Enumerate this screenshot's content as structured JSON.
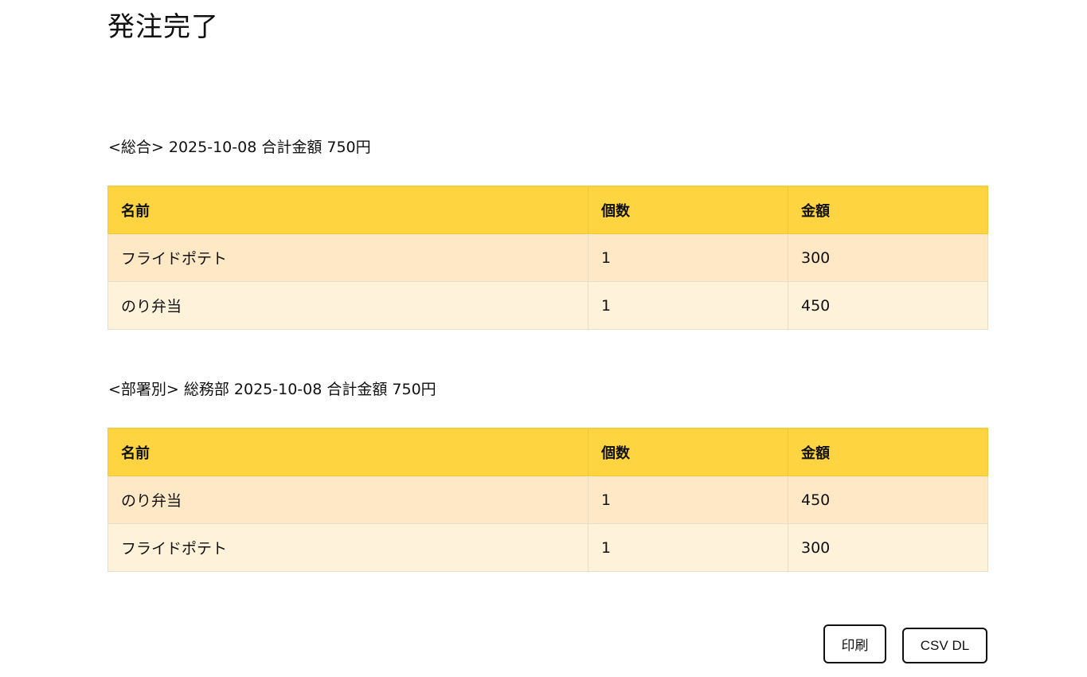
{
  "page": {
    "title": "発注完了"
  },
  "summary": {
    "heading": "<総合> 2025-10-08 合計金額 750円",
    "columns": [
      "名前",
      "個数",
      "金額"
    ],
    "rows": [
      {
        "name": "フライドポテト",
        "qty": "1",
        "price": "300"
      },
      {
        "name": "のり弁当",
        "qty": "1",
        "price": "450"
      }
    ]
  },
  "department": {
    "heading": "<部署別> 総務部 2025-10-08 合計金額 750円",
    "columns": [
      "名前",
      "個数",
      "金額"
    ],
    "rows": [
      {
        "name": "のり弁当",
        "qty": "1",
        "price": "450"
      },
      {
        "name": "フライドポテト",
        "qty": "1",
        "price": "300"
      }
    ]
  },
  "actions": {
    "print_label": "印刷",
    "csv_label": "CSV DL"
  },
  "colors": {
    "header_bg": "#ffd441",
    "row_odd_bg": "#ffe8c5",
    "row_even_bg": "#fff2da"
  }
}
